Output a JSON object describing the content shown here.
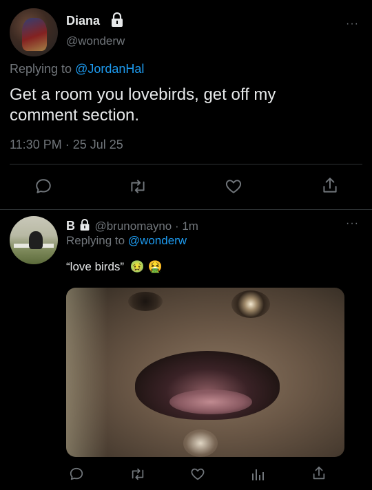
{
  "tweet": {
    "author_name": "Diana",
    "handle": "@wonderw",
    "replying_prefix": "Replying to",
    "replying_to": "@JordanHal",
    "text_line1": "Get a room you lovebirds, get off my",
    "text_line2": "comment section.",
    "timestamp": "11:30 PM · 25 Jul 25",
    "more_label": "···"
  },
  "reply": {
    "author_name": "B",
    "handle": "@brunomayno",
    "time": "· 1m",
    "replying_prefix": "Replying to",
    "replying_to": "@wonderw",
    "text": "“love birds”",
    "emoji_1": "🤢",
    "emoji_2": "🤮",
    "more_label": "···"
  },
  "icons": {
    "lock": "lock-icon",
    "reply": "reply-icon",
    "retweet": "retweet-icon",
    "like": "heart-icon",
    "share": "share-icon",
    "analytics": "analytics-icon"
  },
  "colors": {
    "background": "#000000",
    "text": "#e7e9ea",
    "muted": "#71767b",
    "link": "#1d9bf0",
    "divider": "#2f3336"
  }
}
